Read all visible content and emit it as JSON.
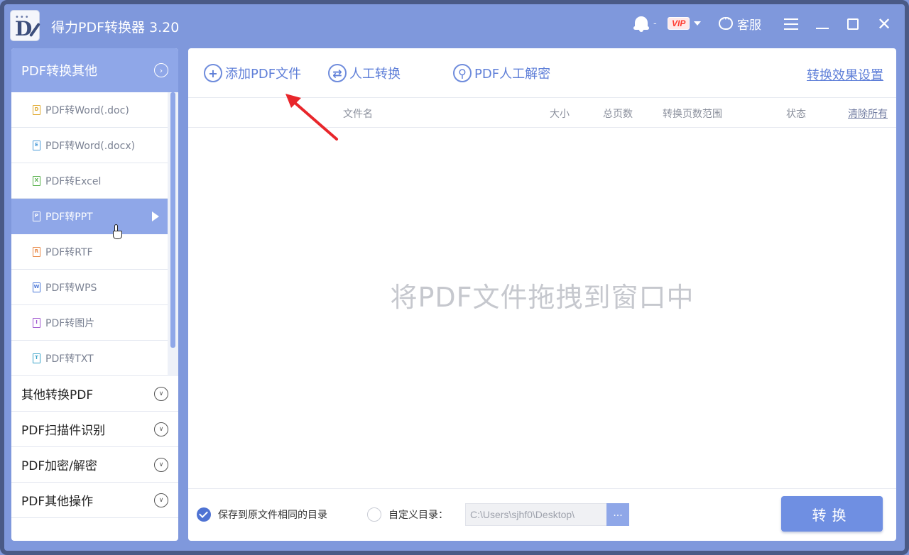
{
  "app": {
    "logo_letter": "D",
    "title": "得力PDF转换器 3.20",
    "bell_suffix": "-",
    "vip_label": "VIP",
    "service_label": "客服",
    "close_glyph": "✕"
  },
  "sidebar": {
    "active_group": "PDF转换其他",
    "items": [
      {
        "label": "PDF转Word(.doc)",
        "icon": "doc-file-icon",
        "icon_glyph": "D"
      },
      {
        "label": "PDF转Word(.docx)",
        "icon": "docx-file-icon",
        "icon_glyph": "E"
      },
      {
        "label": "PDF转Excel",
        "icon": "excel-file-icon",
        "icon_glyph": "X"
      },
      {
        "label": "PDF转PPT",
        "icon": "ppt-file-icon",
        "icon_glyph": "P"
      },
      {
        "label": "PDF转RTF",
        "icon": "rtf-file-icon",
        "icon_glyph": "R"
      },
      {
        "label": "PDF转WPS",
        "icon": "wps-file-icon",
        "icon_glyph": "W"
      },
      {
        "label": "PDF转图片",
        "icon": "image-file-icon",
        "icon_glyph": "I"
      },
      {
        "label": "PDF转TXT",
        "icon": "txt-file-icon",
        "icon_glyph": "T"
      }
    ],
    "selected_item": "PDF转PPT",
    "groups": [
      "其他转换PDF",
      "PDF扫描件识别",
      "PDF加密/解密",
      "PDF其他操作"
    ],
    "group_icon_glyph": "∨",
    "active_group_icon_glyph": "›"
  },
  "toolbar": {
    "add_label": "添加PDF文件",
    "manual_label": "人工转换",
    "decrypt_label": "PDF人工解密",
    "settings_label": "转换效果设置"
  },
  "table": {
    "columns": {
      "name": "文件名",
      "size": "大小",
      "pages": "总页数",
      "range": "转换页数范围",
      "status": "状态",
      "clear": "清除所有"
    }
  },
  "drop_hint": "将PDF文件拖拽到窗口中",
  "footer": {
    "same_dir_label": "保存到原文件相同的目录",
    "same_dir_checked": true,
    "custom_dir_label": "自定义目录：",
    "custom_dir_checked": false,
    "path_value": "C:\\Users\\sjhf0\\Desktop\\",
    "browse_label": "...",
    "convert_label": "转换"
  },
  "colors": {
    "accent": "#6f8fe2",
    "window_bg": "#7f98dc",
    "selected_bg": "#8fa7e8",
    "annotation_arrow": "#e8262b"
  }
}
